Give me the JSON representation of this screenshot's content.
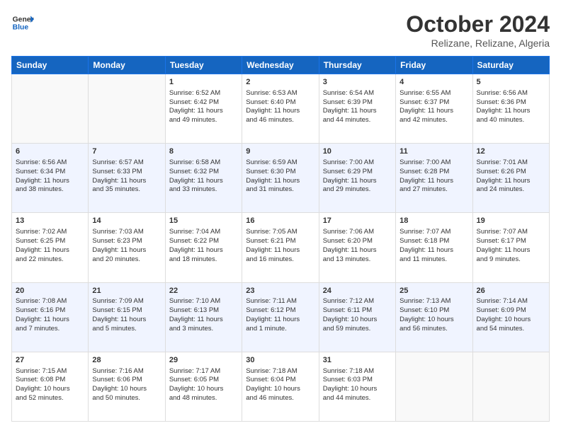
{
  "logo": {
    "line1": "General",
    "line2": "Blue"
  },
  "title": "October 2024",
  "subtitle": "Relizane, Relizane, Algeria",
  "headers": [
    "Sunday",
    "Monday",
    "Tuesday",
    "Wednesday",
    "Thursday",
    "Friday",
    "Saturday"
  ],
  "weeks": [
    [
      {
        "day": "",
        "info": ""
      },
      {
        "day": "",
        "info": ""
      },
      {
        "day": "1",
        "info": "Sunrise: 6:52 AM\nSunset: 6:42 PM\nDaylight: 11 hours\nand 49 minutes."
      },
      {
        "day": "2",
        "info": "Sunrise: 6:53 AM\nSunset: 6:40 PM\nDaylight: 11 hours\nand 46 minutes."
      },
      {
        "day": "3",
        "info": "Sunrise: 6:54 AM\nSunset: 6:39 PM\nDaylight: 11 hours\nand 44 minutes."
      },
      {
        "day": "4",
        "info": "Sunrise: 6:55 AM\nSunset: 6:37 PM\nDaylight: 11 hours\nand 42 minutes."
      },
      {
        "day": "5",
        "info": "Sunrise: 6:56 AM\nSunset: 6:36 PM\nDaylight: 11 hours\nand 40 minutes."
      }
    ],
    [
      {
        "day": "6",
        "info": "Sunrise: 6:56 AM\nSunset: 6:34 PM\nDaylight: 11 hours\nand 38 minutes."
      },
      {
        "day": "7",
        "info": "Sunrise: 6:57 AM\nSunset: 6:33 PM\nDaylight: 11 hours\nand 35 minutes."
      },
      {
        "day": "8",
        "info": "Sunrise: 6:58 AM\nSunset: 6:32 PM\nDaylight: 11 hours\nand 33 minutes."
      },
      {
        "day": "9",
        "info": "Sunrise: 6:59 AM\nSunset: 6:30 PM\nDaylight: 11 hours\nand 31 minutes."
      },
      {
        "day": "10",
        "info": "Sunrise: 7:00 AM\nSunset: 6:29 PM\nDaylight: 11 hours\nand 29 minutes."
      },
      {
        "day": "11",
        "info": "Sunrise: 7:00 AM\nSunset: 6:28 PM\nDaylight: 11 hours\nand 27 minutes."
      },
      {
        "day": "12",
        "info": "Sunrise: 7:01 AM\nSunset: 6:26 PM\nDaylight: 11 hours\nand 24 minutes."
      }
    ],
    [
      {
        "day": "13",
        "info": "Sunrise: 7:02 AM\nSunset: 6:25 PM\nDaylight: 11 hours\nand 22 minutes."
      },
      {
        "day": "14",
        "info": "Sunrise: 7:03 AM\nSunset: 6:23 PM\nDaylight: 11 hours\nand 20 minutes."
      },
      {
        "day": "15",
        "info": "Sunrise: 7:04 AM\nSunset: 6:22 PM\nDaylight: 11 hours\nand 18 minutes."
      },
      {
        "day": "16",
        "info": "Sunrise: 7:05 AM\nSunset: 6:21 PM\nDaylight: 11 hours\nand 16 minutes."
      },
      {
        "day": "17",
        "info": "Sunrise: 7:06 AM\nSunset: 6:20 PM\nDaylight: 11 hours\nand 13 minutes."
      },
      {
        "day": "18",
        "info": "Sunrise: 7:07 AM\nSunset: 6:18 PM\nDaylight: 11 hours\nand 11 minutes."
      },
      {
        "day": "19",
        "info": "Sunrise: 7:07 AM\nSunset: 6:17 PM\nDaylight: 11 hours\nand 9 minutes."
      }
    ],
    [
      {
        "day": "20",
        "info": "Sunrise: 7:08 AM\nSunset: 6:16 PM\nDaylight: 11 hours\nand 7 minutes."
      },
      {
        "day": "21",
        "info": "Sunrise: 7:09 AM\nSunset: 6:15 PM\nDaylight: 11 hours\nand 5 minutes."
      },
      {
        "day": "22",
        "info": "Sunrise: 7:10 AM\nSunset: 6:13 PM\nDaylight: 11 hours\nand 3 minutes."
      },
      {
        "day": "23",
        "info": "Sunrise: 7:11 AM\nSunset: 6:12 PM\nDaylight: 11 hours\nand 1 minute."
      },
      {
        "day": "24",
        "info": "Sunrise: 7:12 AM\nSunset: 6:11 PM\nDaylight: 10 hours\nand 59 minutes."
      },
      {
        "day": "25",
        "info": "Sunrise: 7:13 AM\nSunset: 6:10 PM\nDaylight: 10 hours\nand 56 minutes."
      },
      {
        "day": "26",
        "info": "Sunrise: 7:14 AM\nSunset: 6:09 PM\nDaylight: 10 hours\nand 54 minutes."
      }
    ],
    [
      {
        "day": "27",
        "info": "Sunrise: 7:15 AM\nSunset: 6:08 PM\nDaylight: 10 hours\nand 52 minutes."
      },
      {
        "day": "28",
        "info": "Sunrise: 7:16 AM\nSunset: 6:06 PM\nDaylight: 10 hours\nand 50 minutes."
      },
      {
        "day": "29",
        "info": "Sunrise: 7:17 AM\nSunset: 6:05 PM\nDaylight: 10 hours\nand 48 minutes."
      },
      {
        "day": "30",
        "info": "Sunrise: 7:18 AM\nSunset: 6:04 PM\nDaylight: 10 hours\nand 46 minutes."
      },
      {
        "day": "31",
        "info": "Sunrise: 7:18 AM\nSunset: 6:03 PM\nDaylight: 10 hours\nand 44 minutes."
      },
      {
        "day": "",
        "info": ""
      },
      {
        "day": "",
        "info": ""
      }
    ]
  ]
}
